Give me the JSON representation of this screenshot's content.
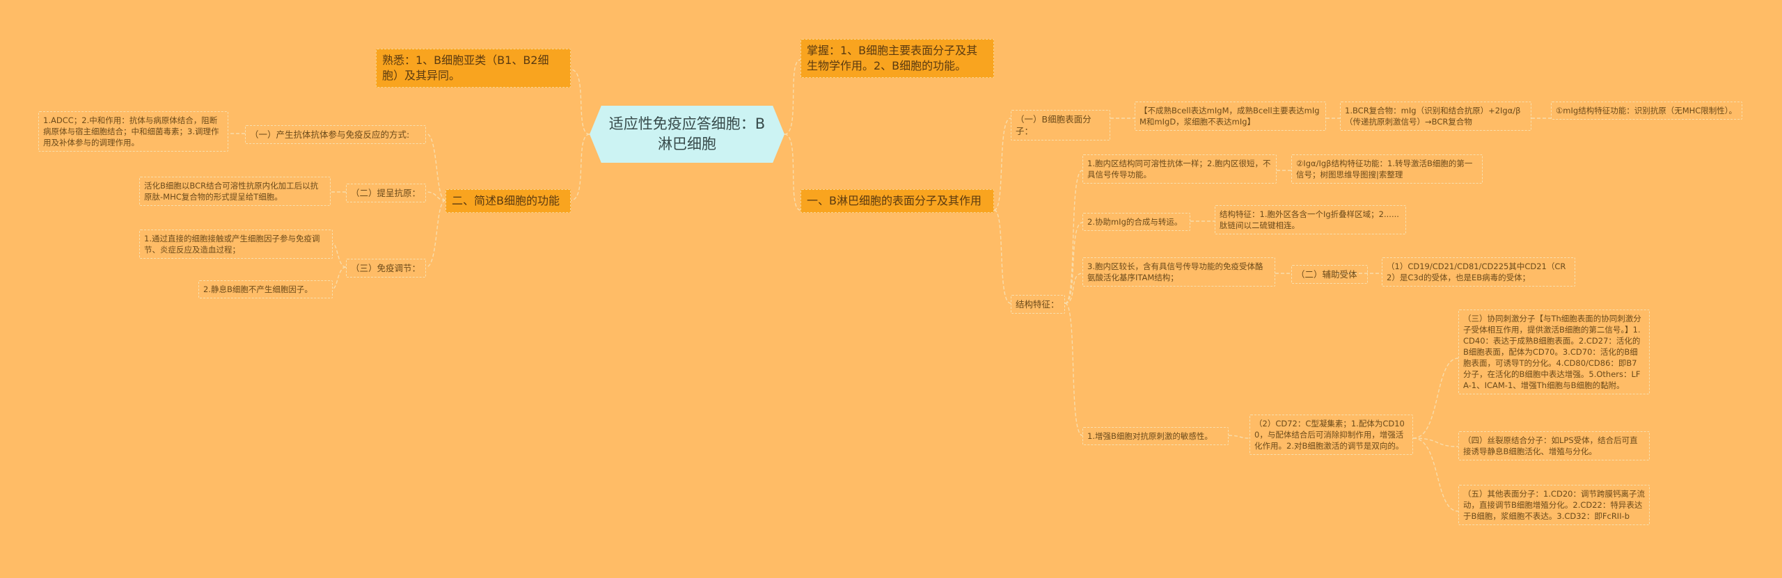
{
  "colors": {
    "background": "#ffbc66",
    "root_fill": "#ccf3f3",
    "main_branch_fill": "#f9a41f",
    "link": "#f8dcaa"
  },
  "root": "适应性免疫应答细胞：B淋巴细胞",
  "left": {
    "familiar": "熟悉：1、B细胞亚类（B1、B2细胞）及其异同。",
    "functions": {
      "title": "二、简述B细胞的功能",
      "antibody": {
        "label": "（一）产生抗体抗体参与免疫反应的方式:",
        "detail": "1.ADCC；2.中和作用：抗体与病原体结合，阻断病原体与宿主细胞结合；中和细菌毒素；3.调理作用及补体参与的调理作用。"
      },
      "antigen": {
        "label": "（二）提呈抗原：",
        "detail": "活化B细胞以BCR结合可溶性抗原内化加工后以抗原肽-MHC复合物的形式提呈给T细胞。"
      },
      "immune_regulation": {
        "label": "（三）免疫调节：",
        "detail1": "1.通过直接的细胞接触或产生细胞因子参与免疫调节、炎症反应及造血过程；",
        "detail2": "2.静息B细胞不产生细胞因子。"
      }
    }
  },
  "right": {
    "master": "掌握：1、B细胞主要表面分子及其生物学作用。2、B细胞的功能。",
    "surface": {
      "title": "一、B淋巴细胞的表面分子及其作用",
      "antigen_receptor": {
        "label": "（一）B细胞表面分子：",
        "note1": "【不成熟Bcell表达mIgM，成熟Bcell主要表达mIgM和mIgD，浆细胞不表达mIg】",
        "note2": "1.BCR复合物：mIg（识别和结合抗原）+2Igα/β（传递抗原刺激信号）→BCR复合物",
        "note3": "①mIg结构特征功能：识别抗原（无MHC限制性）。"
      },
      "structure": {
        "label": "结构特征：",
        "item1": "1.胞内区结构同可溶性抗体一样；2.胞内区很短，不具信号传导功能。",
        "item1_detail": "②Igα/Igβ结构特征功能：1.转导激活B细胞的第一信号；树图思维导图搜|索整理",
        "item2": "2.协助mIg的合成与转运。",
        "item2_detail": "结构特征：1.胞外区各含一个Ig折叠样区域；2......肽链间以二硫键相连。",
        "item3": "3.胞内区较长，含有具信号传导功能的免疫受体酪氨酸活化基序ITAM结构；",
        "coreceptor": "（二）辅助受体",
        "cd19": "（1）CD19/CD21/CD81/CD225其中CD21（CR2）是C3d的受体，也是EB病毒的受体；",
        "item4": "1.增强B细胞对抗原刺激的敏感性。",
        "cd72": "（2）CD72：C型凝集素；1.配体为CD100，与配体结合后可消除抑制作用，增强活化作用。2.对B细胞激活的调节是双向的。",
        "costim": "（三）协同刺激分子【与Th细胞表面的协同刺激分子受体相互作用，提供激活B细胞的第二信号。】1.CD40：表达于成熟B细胞表面。2.CD27：活化的B细胞表面，配体为CD70。3.CD70：活化的B细胞表面，可诱导T的分化。4.CD80/CD86：即B7分子，在活化的B细胞中表达增强。5.Others：LFA-1、ICAM-1、增强Th细胞与B细胞的黏附。",
        "mitogen": "（四）丝裂原结合分子：如LPS受体，结合后可直接诱导静息B细胞活化、增殖与分化。",
        "others": "（五）其他表面分子：1.CD20：调节跨膜钙离子流动，直接调节B细胞增殖分化。2.CD22：特异表达于B细胞，浆细胞不表达。3.CD32：即FcRII-b"
      }
    }
  }
}
